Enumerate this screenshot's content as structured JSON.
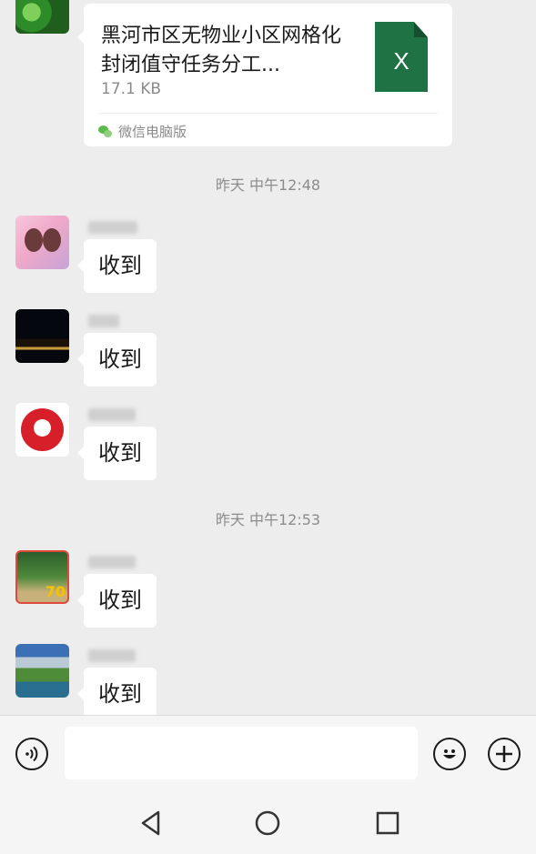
{
  "messages": {
    "file": {
      "name": "黑河市区无物业小区网格化封闭值守任务分工...",
      "size": "17.1 KB",
      "file_type_letter": "X",
      "source": "微信电脑版"
    },
    "timestamp_1": "昨天 中午12:48",
    "timestamp_2": "昨天 中午12:53",
    "replies": [
      "收到",
      "收到",
      "收到",
      "收到",
      "收到"
    ]
  },
  "icons": {
    "voice": "voice-icon",
    "emoji": "emoji-icon",
    "plus": "plus-icon",
    "nav_back": "back-triangle-icon",
    "nav_home": "home-circle-icon",
    "nav_recent": "recent-square-icon"
  },
  "colors": {
    "chat_background": "#ededed",
    "bubble": "#ffffff",
    "excel_green": "#1f7244",
    "wechat_green": "#5bbb4b"
  }
}
